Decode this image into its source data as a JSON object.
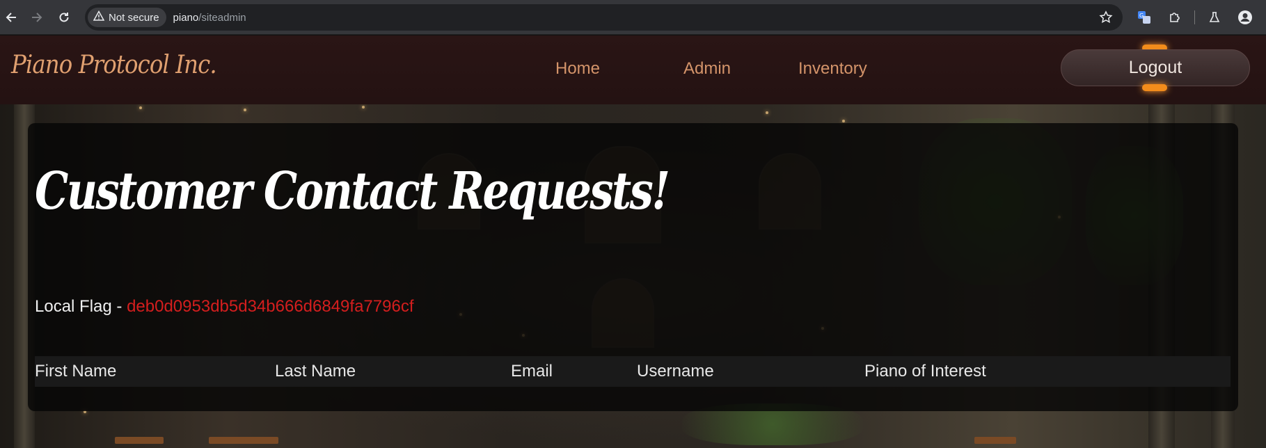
{
  "browser": {
    "security_label": "Not secure",
    "url_host": "piano",
    "url_path": "/siteadmin"
  },
  "site": {
    "logo": "Piano Protocol Inc.",
    "nav": [
      "Home",
      "Admin",
      "Inventory"
    ],
    "logout_label": "Logout"
  },
  "page": {
    "heading": "Customer Contact Requests!",
    "flag_label": "Local Flag - ",
    "flag_value": "deb0d0953db5d34b666d6849fa7796cf",
    "table_columns": [
      "First Name",
      "Last Name",
      "Email",
      "Username",
      "Piano of Interest"
    ]
  },
  "colors": {
    "accent": "#d4946a",
    "flag": "#d41e1e",
    "logout_glow": "#f28c1b"
  }
}
